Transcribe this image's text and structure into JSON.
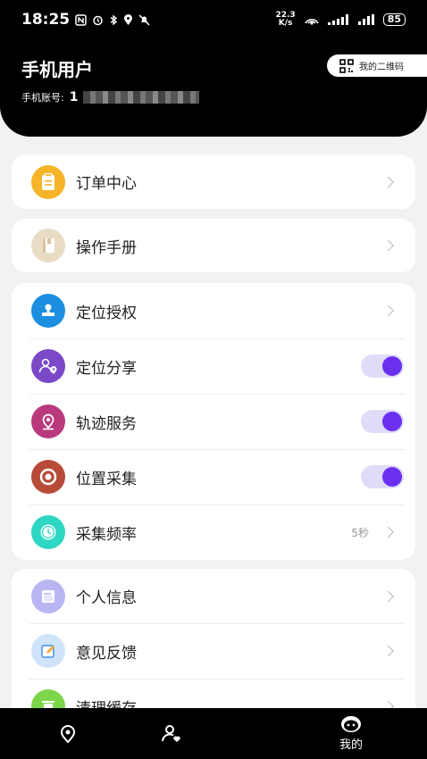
{
  "status_bar": {
    "time": "18:25",
    "speed_value": "22.3",
    "speed_unit": "K/s",
    "battery": "85"
  },
  "header": {
    "title": "手机用户",
    "account_label": "手机账号:",
    "account_value": "1",
    "qr_label": "我的二维码"
  },
  "menu": {
    "orders": "订单中心",
    "manual": "操作手册",
    "location_auth": "定位授权",
    "location_share": "定位分享",
    "track_service": "轨迹服务",
    "location_collect": "位置采集",
    "collect_freq": "采集频率",
    "collect_freq_value": "5秒",
    "profile": "个人信息",
    "feedback": "意见反馈",
    "clear_cache": "清理缓存"
  },
  "toggles": {
    "location_share": true,
    "track_service": true,
    "location_collect": true
  },
  "tabs": {
    "mine": "我的"
  },
  "colors": {
    "accent": "#6b2ff0",
    "toggle_track": "#e0dcf8"
  }
}
